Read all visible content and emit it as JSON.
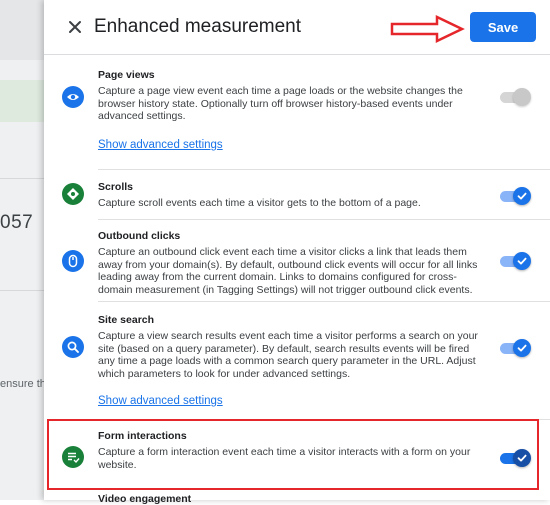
{
  "background_page": {
    "big_number_fragment": "057",
    "small_text_fragment": "ensure tha"
  },
  "panel": {
    "title": "Enhanced measurement",
    "save_label": "Save",
    "arrow_color": "#e5262a",
    "highlight_color": "#e5262a",
    "accent": "#1a73e8",
    "icon_colors": {
      "blue": "#1a73e8",
      "green": "#188038"
    }
  },
  "sections": [
    {
      "title": "Page views",
      "description": "Capture a page view event each time a page loads or the website changes the browser history state. Optionally turn off browser history-based events under advanced settings.",
      "link": "Show advanced settings",
      "icon": "eye-icon",
      "toggle": "on-disabled"
    },
    {
      "title": "Scrolls",
      "description": "Capture scroll events each time a visitor gets to the bottom of a page.",
      "icon": "compass-icon",
      "toggle": "on"
    },
    {
      "title": "Outbound clicks",
      "description": "Capture an outbound click event each time a visitor clicks a link that leads them away from your domain(s). By default, outbound click events will occur for all links leading away from the current domain. Links to domains configured for cross-domain measurement (in Tagging Settings) will not trigger outbound click events.",
      "icon": "mouse-icon",
      "toggle": "on"
    },
    {
      "title": "Site search",
      "description": "Capture a view search results event each time a visitor performs a search on your site (based on a query parameter). By default, search results events will be fired any time a page loads with a common search query parameter in the URL. Adjust which parameters to look for under advanced settings.",
      "link": "Show advanced settings",
      "icon": "search-icon",
      "toggle": "on"
    },
    {
      "title": "Form interactions",
      "description": "Capture a form interaction event each time a visitor interacts with a form on your website.",
      "icon": "form-icon",
      "toggle": "on"
    }
  ],
  "cutoff_next_title": "Video engagement"
}
